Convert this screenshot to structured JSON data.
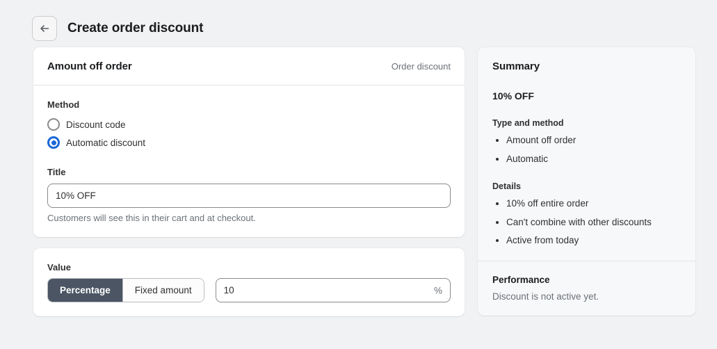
{
  "header": {
    "back_icon": "arrow-left-icon",
    "title": "Create order discount"
  },
  "main": {
    "discount_card": {
      "title": "Amount off order",
      "meta": "Order discount",
      "method": {
        "label": "Method",
        "options": [
          {
            "label": "Discount code",
            "selected": false
          },
          {
            "label": "Automatic discount",
            "selected": true
          }
        ]
      },
      "title_field": {
        "label": "Title",
        "value": "10% OFF",
        "placeholder": "",
        "help": "Customers will see this in their cart and at checkout."
      }
    },
    "value_card": {
      "label": "Value",
      "segments": [
        {
          "label": "Percentage",
          "active": true
        },
        {
          "label": "Fixed amount",
          "active": false
        }
      ],
      "amount": {
        "value": "10",
        "placeholder": "",
        "suffix": "%"
      }
    }
  },
  "summary": {
    "title": "Summary",
    "headline": "10% OFF",
    "groups": [
      {
        "label": "Type and method",
        "items": [
          "Amount off order",
          "Automatic"
        ]
      },
      {
        "label": "Details",
        "items": [
          "10% off entire order",
          "Can't combine with other discounts",
          "Active from today"
        ]
      }
    ],
    "performance": {
      "title": "Performance",
      "text": "Discount is not active yet."
    }
  },
  "colors": {
    "page_background": "#f1f2f4",
    "card_background": "#ffffff",
    "summary_background": "#f7f8fa",
    "accent_radio": "#1a68d8",
    "segment_active": "#4b5563",
    "text_primary": "#303030",
    "text_subdued": "#6b7177"
  }
}
